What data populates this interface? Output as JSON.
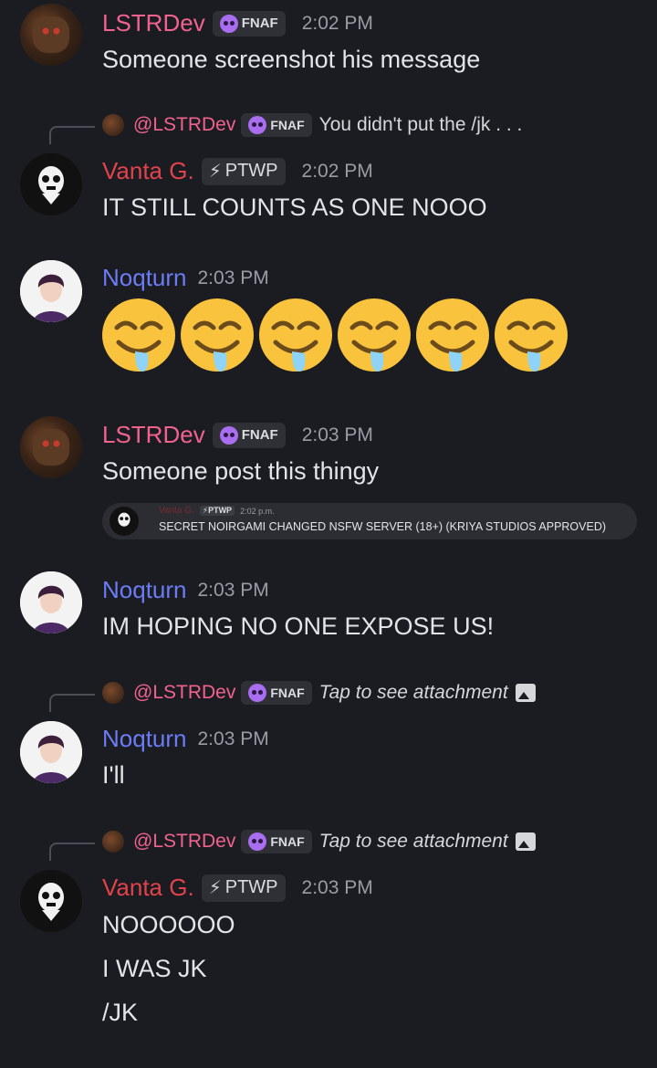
{
  "messages": [
    {
      "author": "LSTRDev",
      "tag": "FNAF",
      "time": "2:02 PM",
      "lines": [
        "Someone screenshot his message"
      ]
    },
    {
      "reply": {
        "author": "@LSTRDev",
        "tag": "FNAF",
        "text": "You didn't put the /jk . . ."
      },
      "author": "Vanta G.",
      "tag": "PTWP",
      "time": "2:02 PM",
      "lines": [
        "IT STILL COUNTS AS ONE NOOO"
      ]
    },
    {
      "author": "Noqturn",
      "time": "2:03 PM",
      "emoji": "drooling-face",
      "emoji_count": 6
    },
    {
      "author": "LSTRDev",
      "tag": "FNAF",
      "time": "2:03 PM",
      "lines": [
        "Someone post this thingy"
      ],
      "embed": {
        "author": "Vanta G.",
        "tag": "PTWP",
        "time": "2:02 p.m.",
        "text": "SECRET NOIRGAMI CHANGED NSFW SERVER (18+) (KRIYA STUDIOS APPROVED)"
      }
    },
    {
      "author": "Noqturn",
      "time": "2:03 PM",
      "lines": [
        "IM HOPING NO ONE EXPOSE US!"
      ]
    },
    {
      "reply": {
        "author": "@LSTRDev",
        "tag": "FNAF",
        "text": "Tap to see attachment"
      },
      "author": "Noqturn",
      "time": "2:03 PM",
      "lines": [
        "I'll"
      ]
    },
    {
      "reply": {
        "author": "@LSTRDev",
        "tag": "FNAF",
        "text": "Tap to see attachment"
      },
      "author": "Vanta G.",
      "tag": "PTWP",
      "time": "2:03 PM",
      "lines": [
        "NOOOOOO",
        "I WAS JK",
        "/JK"
      ]
    }
  ],
  "colors": {
    "lstrdev": "#f2628f",
    "vanta": "#e0434b",
    "noqturn": "#6b7cf5",
    "background": "#1b1c21"
  }
}
